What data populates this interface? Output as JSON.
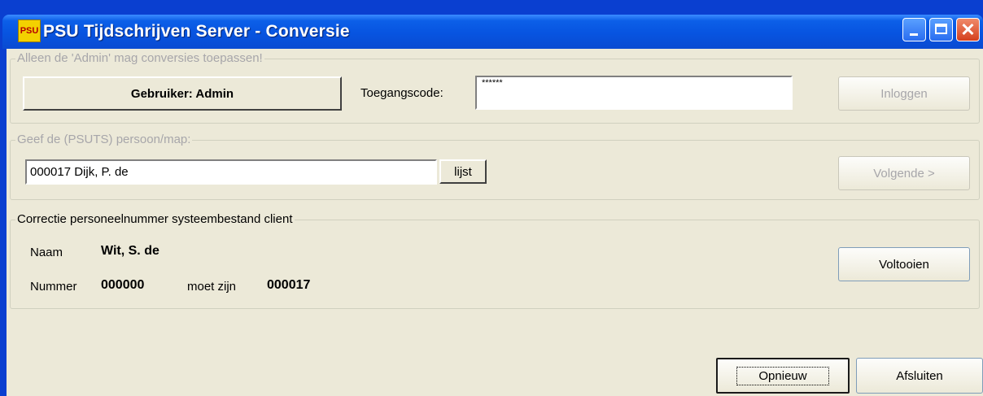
{
  "window": {
    "title": "PSU Tijdschrijven Server - Conversie",
    "icon": "app-logo-icon",
    "close_glyph": "✕"
  },
  "login": {
    "group_label": "Alleen de 'Admin' mag conversies toepassen!",
    "user_label": "Gebruiker: Admin",
    "code_label": "Toegangscode:",
    "code_value": "******",
    "login_button": "Inloggen"
  },
  "person": {
    "group_label": "Geef de (PSUTS) persoon/map:",
    "value": "000017 Dijk, P. de",
    "list_button": "lijst",
    "next_button": "Volgende >"
  },
  "correction": {
    "group_label": "Correctie personeelnummer systeembestand client",
    "name_label": "Naam",
    "name_value": "Wit, S. de",
    "number_label": "Nummer",
    "number_value": "000000",
    "should_be_label": "moet zijn",
    "should_be_value": "000017",
    "complete_button": "Voltooien"
  },
  "footer": {
    "restart_button": "Opnieuw",
    "close_button": "Afsluiten"
  },
  "colors": {
    "titlebar": "#0754e0",
    "client_bg": "#ece9d8",
    "disabled_text": "#a7a6aa"
  }
}
